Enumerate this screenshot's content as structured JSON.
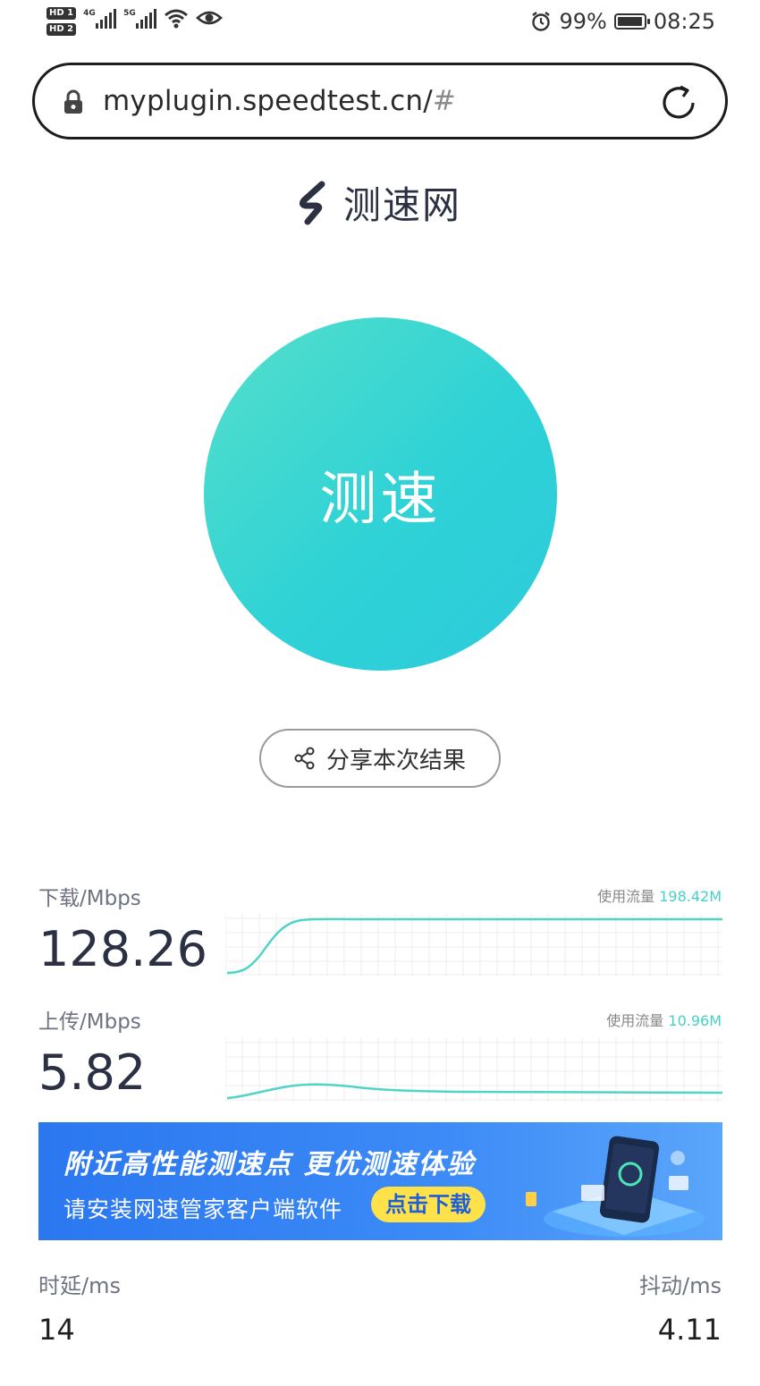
{
  "status_bar": {
    "hd1": "HD 1",
    "hd2": "HD 2",
    "network1": "4G",
    "network2": "5G",
    "battery": "99%",
    "time": "08:25",
    "icons": [
      "wifi-icon",
      "eye-icon",
      "alarm-icon",
      "battery-icon"
    ]
  },
  "browser": {
    "url_main": "myplugin.speedtest.cn/",
    "url_hash": "#"
  },
  "logo": {
    "text": "测速网"
  },
  "test_button": {
    "label": "测速"
  },
  "share_button": {
    "label": "分享本次结果"
  },
  "download": {
    "label": "下载/Mbps",
    "value": "128.26",
    "traffic_label": "使用流量",
    "traffic_value": "198.42M"
  },
  "upload": {
    "label": "上传/Mbps",
    "value": "5.82",
    "traffic_label": "使用流量",
    "traffic_value": "10.96M"
  },
  "banner": {
    "title": "附近高性能测速点  更优测速体验",
    "subtitle": "请安装网速管家客户端软件",
    "cta": "点击下载"
  },
  "latency": {
    "label": "时延/ms",
    "value": "14"
  },
  "jitter": {
    "label": "抖动/ms",
    "value": "4.11"
  },
  "colors": {
    "accent": "#2fd2d6",
    "banner": "#2a77f0",
    "cta": "#ffe14a"
  }
}
